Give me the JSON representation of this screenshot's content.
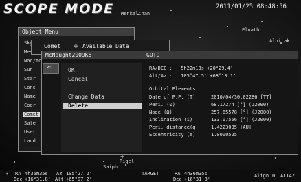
{
  "header": {
    "mode_title": "SCOPE MODE",
    "datetime": "2011/01/25 08:48:56"
  },
  "sky_labels": [
    "Menkalinan",
    "Elnath",
    "Rigel",
    "Saiph",
    "Alnitak"
  ],
  "object_menu": {
    "title": "Object Menu",
    "items": [
      "Sky",
      "Mess",
      "NGC/IC",
      "Sun",
      "Star",
      "Cons",
      "Name",
      "Coor",
      "Comet",
      "Sate",
      "User",
      "Land"
    ],
    "selected_index": 8
  },
  "available_data": {
    "category": "Comet",
    "label": "Available Data"
  },
  "detail": {
    "object_name": "McNaught2009K5",
    "action": "GOTO",
    "menu_items": [
      "OK",
      "Cancel",
      "Change Data",
      "Delete"
    ],
    "selected_menu_index": 3,
    "radec_label": "RA/DEC :",
    "radec_value": "5h22m13s  +20°29.4'",
    "altaz_label": "Alt/Az :",
    "altaz_value": "105°47.5'  +68°13.1'",
    "orbital_title": "Orbital Elements",
    "elements": [
      {
        "label": "Date of P.P. (T)",
        "value": "2010/04/30.02286 [TT]"
      },
      {
        "label": "Peri.        (ω)",
        "value": "68.17274 [°] (J2000)"
      },
      {
        "label": "Node         (Ω)",
        "value": "257.65578 [°] (J2000)"
      },
      {
        "label": "Inclination  (i)",
        "value": "133.07556 [°] (J2000)"
      },
      {
        "label": "Peri. distance(q)",
        "value": "1.4223035 [AU]"
      },
      {
        "label": "Eccentricity (e)",
        "value": "1.0000525"
      }
    ]
  },
  "status_bar": {
    "ra_label": "RA",
    "ra_value": "4h36m35s",
    "az_label": "Az",
    "az_value": "105°27.2'",
    "dec_label": "Dec",
    "dec_value": "+16°31.8'",
    "alt_label": "Alt",
    "alt_value": "+65°07.2'",
    "target_label": "TARGET",
    "target_ra_label": "RA",
    "target_ra_value": "4h36m35s",
    "target_dec_label": "Dec",
    "target_dec_value": "+16°31.8'",
    "align_label": "Align",
    "align_value": "0",
    "alt_az_label": "ALTAZ"
  }
}
